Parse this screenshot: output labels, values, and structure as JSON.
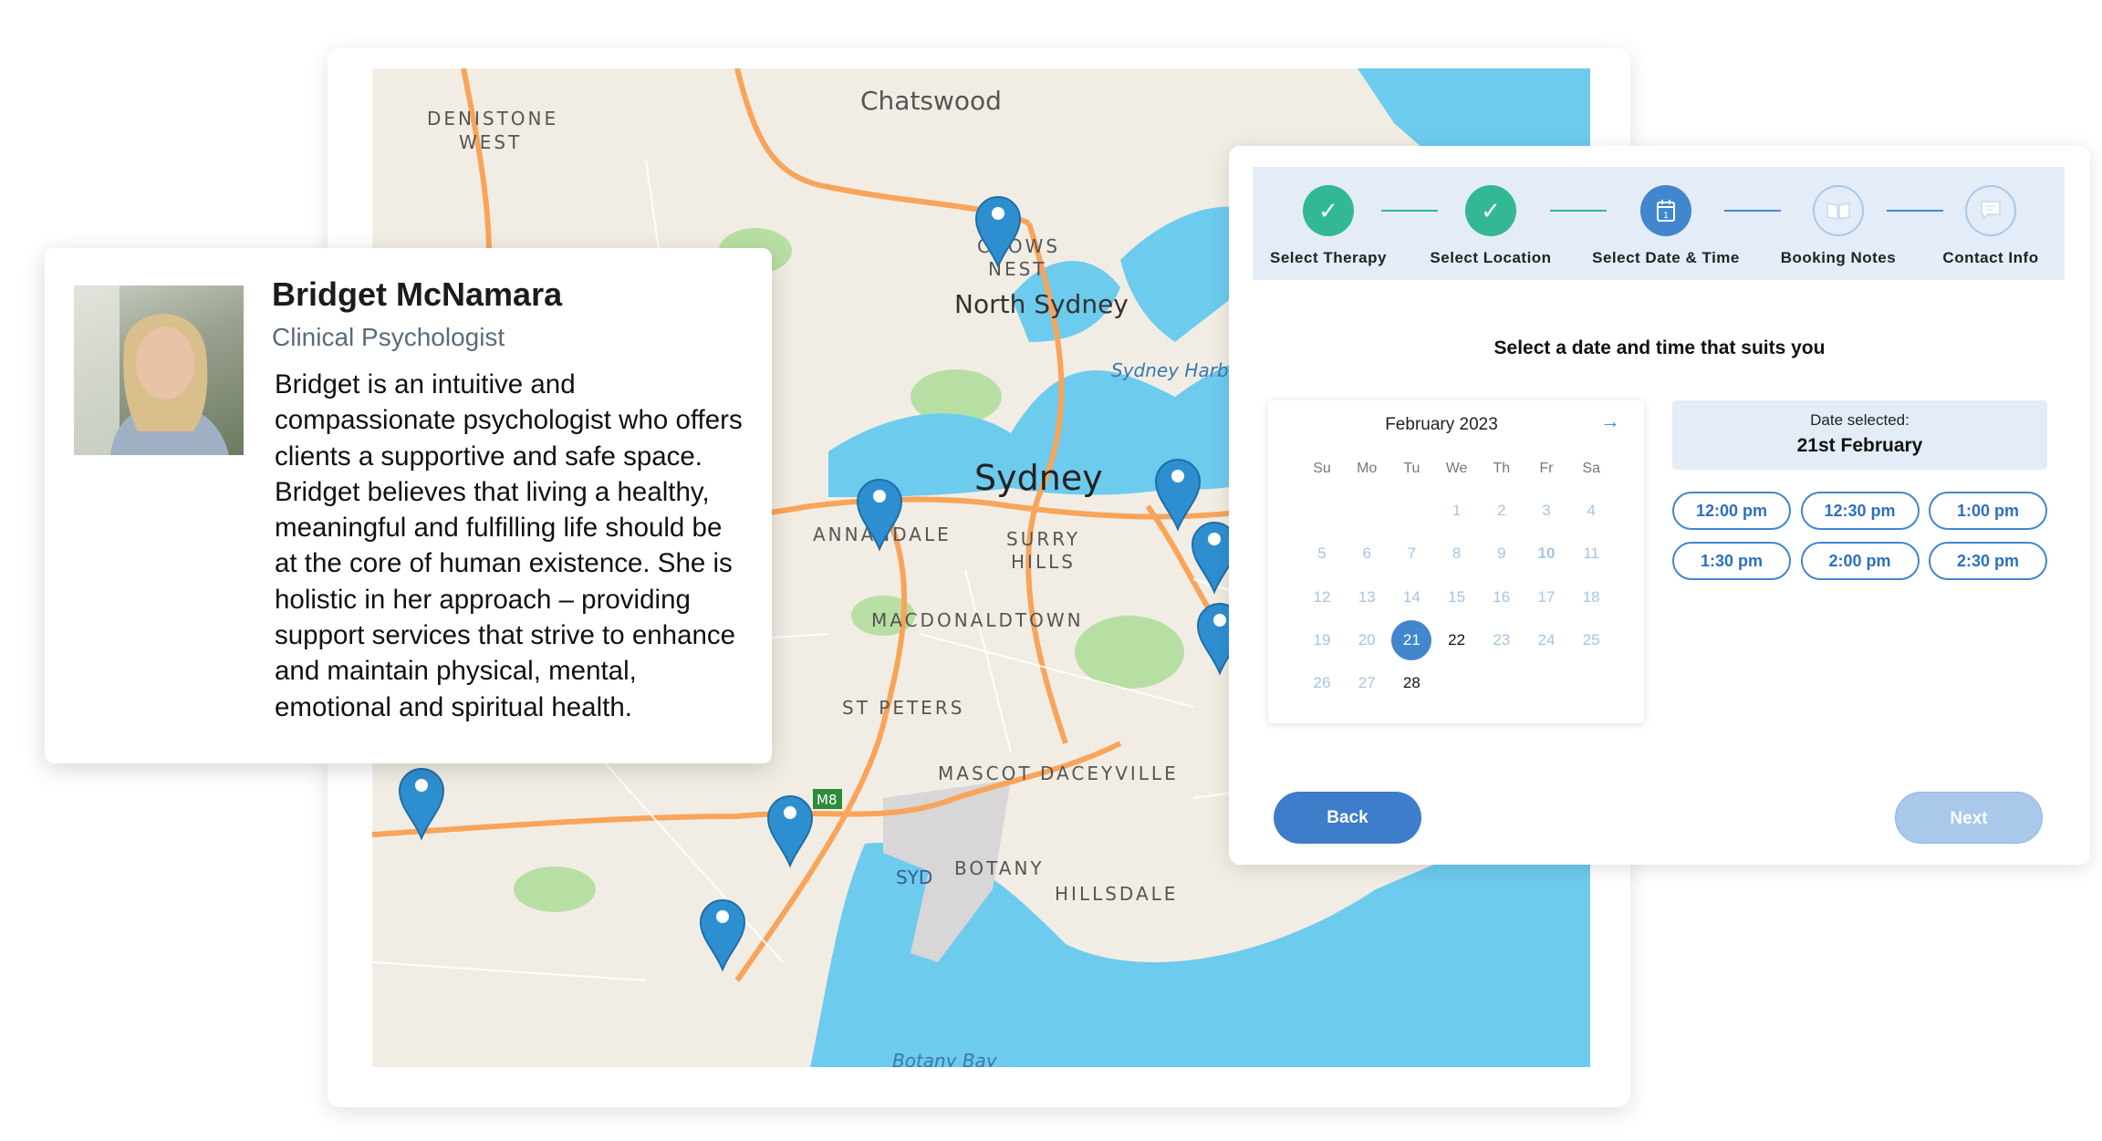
{
  "map": {
    "labels": [
      "Chatswood",
      "DENISTONE",
      "WEST",
      "CROWS",
      "NEST",
      "North Sydney",
      "Sydney Harbour",
      "Sydney",
      "ANNANDALE",
      "SURRY",
      "HILLS",
      "MACDONALDTOWN",
      "ST PETERS",
      "MASCOT",
      "DACEYVILLE",
      "BOTANY",
      "HILLSDALE",
      "SYD",
      "M8",
      "Botany Bay"
    ],
    "colors": {
      "land": "#f2ede4",
      "water": "#6dcbee",
      "park": "#b8dfa3",
      "road": "#f8a45a"
    }
  },
  "profile": {
    "name": "Bridget McNamara",
    "role": "Clinical Psychologist",
    "bio": "Bridget is an intuitive and compassionate psychologist who offers clients a supportive and safe space. Bridget believes that living a healthy, meaningful and fulfilling life should be at the core of human existence. She is holistic in her approach – providing support services that strive to enhance and maintain physical, mental, emotional and spiritual health."
  },
  "booking": {
    "steps": [
      {
        "label": "Select Therapy",
        "state": "done",
        "icon": "check-icon"
      },
      {
        "label": "Select Location",
        "state": "done",
        "icon": "check-icon"
      },
      {
        "label": "Select Date & Time",
        "state": "current",
        "icon": "calendar-icon"
      },
      {
        "label": "Booking Notes",
        "state": "todo",
        "icon": "book-icon"
      },
      {
        "label": "Contact Info",
        "state": "todo",
        "icon": "chat-icon"
      }
    ],
    "heading": "Select a date and time that suits you",
    "calendar": {
      "month": "February 2023",
      "weekdays": [
        "Su",
        "Mo",
        "Tu",
        "We",
        "Th",
        "Fr",
        "Sa"
      ],
      "first_weekday_index": 3,
      "days_in_month": 28,
      "selected_day": 21,
      "available_days": [
        22,
        28
      ],
      "bold_days": [
        10
      ]
    },
    "date_selected_label": "Date selected:",
    "date_selected_value": "21st February",
    "times": [
      "12:00 pm",
      "12:30 pm",
      "1:00 pm",
      "1:30 pm",
      "2:00 pm",
      "2:30 pm"
    ],
    "back_label": "Back",
    "next_label": "Next",
    "colors": {
      "primary": "#4286cd",
      "done": "#33b894",
      "panel_bg": "#e4ecf7"
    }
  }
}
